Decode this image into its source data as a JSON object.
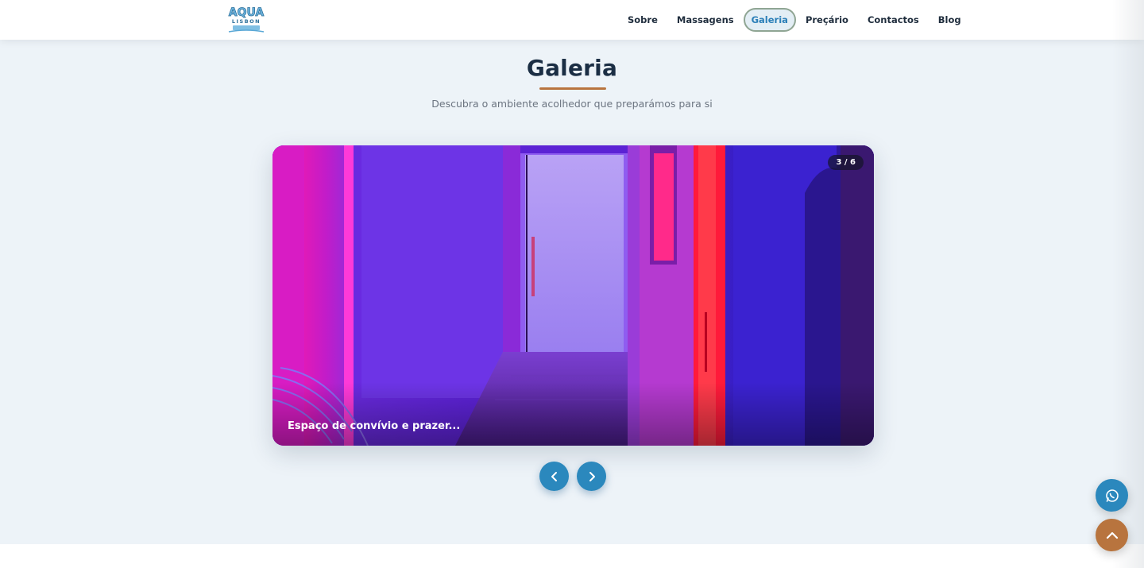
{
  "brand": {
    "logo_text": "AQUA",
    "logo_subtext": "LISBON",
    "accent": "#2b88bd",
    "secondary": "#b8743e"
  },
  "nav": {
    "items": [
      {
        "label": "Sobre"
      },
      {
        "label": "Massagens"
      },
      {
        "label": "Galeria",
        "active": true
      },
      {
        "label": "Preçário"
      },
      {
        "label": "Contactos"
      },
      {
        "label": "Blog"
      }
    ]
  },
  "gallery": {
    "title": "Galeria",
    "subtitle": "Descubra o ambiente acolhedor que preparámos para si",
    "counter": "3 / 6",
    "caption": "Espaço de convívio e prazer..."
  },
  "controls": {
    "prev_icon": "chevron-left-icon",
    "next_icon": "chevron-right-icon",
    "whatsapp_icon": "whatsapp-icon",
    "scroll_top_icon": "chevron-up-icon"
  }
}
